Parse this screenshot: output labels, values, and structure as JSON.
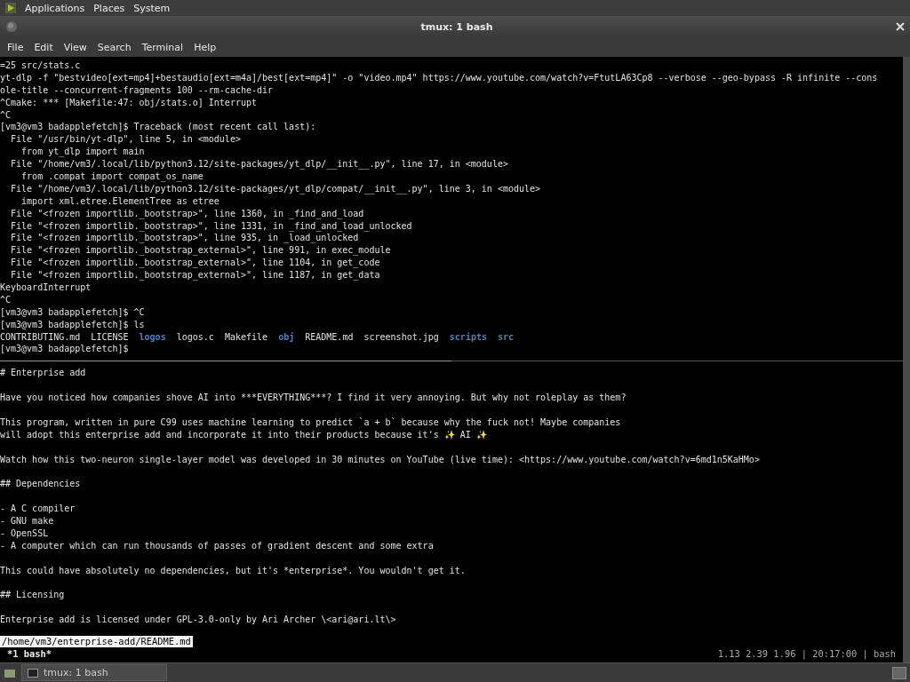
{
  "top_panel": {
    "menus": [
      "Applications",
      "Places",
      "System"
    ]
  },
  "window": {
    "title": "tmux: 1 bash"
  },
  "menubar": [
    "File",
    "Edit",
    "View",
    "Search",
    "Terminal",
    "Help"
  ],
  "top_pane": {
    "lines": [
      {
        "kind": "text",
        "text": "=25 src/stats.c"
      },
      {
        "kind": "text",
        "text": "yt-dlp -f \"bestvideo[ext=mp4]+bestaudio[ext=m4a]/best[ext=mp4]\" -o \"video.mp4\" https://www.youtube.com/watch?v=FtutLA63Cp8 --verbose --geo-bypass -R infinite --cons"
      },
      {
        "kind": "text",
        "text": "ole-title --concurrent-fragments 100 --rm-cache-dir"
      },
      {
        "kind": "text",
        "text": "^Cmake: *** [Makefile:47: obj/stats.o] Interrupt"
      },
      {
        "kind": "text",
        "text": "^C"
      },
      {
        "kind": "text",
        "text": "[vm3@vm3 badapplefetch]$ Traceback (most recent call last):"
      },
      {
        "kind": "text",
        "text": "  File \"/usr/bin/yt-dlp\", line 5, in <module>"
      },
      {
        "kind": "text",
        "text": "    from yt_dlp import main"
      },
      {
        "kind": "text",
        "text": "  File \"/home/vm3/.local/lib/python3.12/site-packages/yt_dlp/__init__.py\", line 17, in <module>"
      },
      {
        "kind": "text",
        "text": "    from .compat import compat_os_name"
      },
      {
        "kind": "text",
        "text": "  File \"/home/vm3/.local/lib/python3.12/site-packages/yt_dlp/compat/__init__.py\", line 3, in <module>"
      },
      {
        "kind": "text",
        "text": "    import xml.etree.ElementTree as etree"
      },
      {
        "kind": "text",
        "text": "  File \"<frozen importlib._bootstrap>\", line 1360, in _find_and_load"
      },
      {
        "kind": "text",
        "text": "  File \"<frozen importlib._bootstrap>\", line 1331, in _find_and_load_unlocked"
      },
      {
        "kind": "text",
        "text": "  File \"<frozen importlib._bootstrap>\", line 935, in _load_unlocked"
      },
      {
        "kind": "text",
        "text": "  File \"<frozen importlib._bootstrap_external>\", line 991, in exec_module"
      },
      {
        "kind": "text",
        "text": "  File \"<frozen importlib._bootstrap_external>\", line 1104, in get_code"
      },
      {
        "kind": "text",
        "text": "  File \"<frozen importlib._bootstrap_external>\", line 1187, in get_data"
      },
      {
        "kind": "text",
        "text": "KeyboardInterrupt"
      },
      {
        "kind": "text",
        "text": "^C"
      },
      {
        "kind": "text",
        "text": "[vm3@vm3 badapplefetch]$ ^C"
      },
      {
        "kind": "text",
        "text": "[vm3@vm3 badapplefetch]$ ls"
      },
      {
        "kind": "listing",
        "entries": [
          {
            "name": "CONTRIBUTING.md",
            "directory": false
          },
          {
            "name": "LICENSE",
            "directory": false
          },
          {
            "name": "logos",
            "directory": true
          },
          {
            "name": "logos.c",
            "directory": false
          },
          {
            "name": "Makefile",
            "directory": false
          },
          {
            "name": "obj",
            "directory": true
          },
          {
            "name": "README.md",
            "directory": false
          },
          {
            "name": "screenshot.jpg",
            "directory": false
          },
          {
            "name": "scripts",
            "directory": true
          },
          {
            "name": "src",
            "directory": true
          }
        ]
      },
      {
        "kind": "text",
        "text": "[vm3@vm3 badapplefetch]$"
      }
    ]
  },
  "bottom_pane": {
    "blocks": [
      [
        "# Enterprise add"
      ],
      [
        "Have you noticed how companies shove AI into ***EVERYTHING***? I find it very annoying. But why not roleplay as them?"
      ],
      [
        "This program, written in pure C99 uses machine learning to predict `a + b` because why the fuck not! Maybe companies",
        "will adopt this enterprise add and incorporate it into their products because it's ✨ AI ✨"
      ],
      [
        "Watch how this two-neuron single-layer model was developed in 30 minutes on YouTube (live time): <https://www.youtube.com/watch?v=6md1n5KaHMo>"
      ],
      [
        "## Dependencies"
      ],
      [
        "- A C compiler",
        "- GNU make",
        "- OpenSSL",
        "- A computer which can run thousands of passes of gradient descent and some extra"
      ],
      [
        "This could have absolutely no dependencies, but it's *enterprise*. You wouldn't get it."
      ],
      [
        "## Licensing"
      ],
      [
        "Enterprise add is licensed under GPL-3.0-only by Ari Archer \\<ari@ari.lt\\>"
      ]
    ]
  },
  "prompt_line": "/home/vm3/enterprise-add/README.md",
  "tmux_status": {
    "window": "*1 bash*",
    "right": "1.13 2.39 1.96 | 20:17:00 | bash"
  },
  "taskbar": {
    "tasks": [
      "tmux: 1 bash"
    ]
  }
}
